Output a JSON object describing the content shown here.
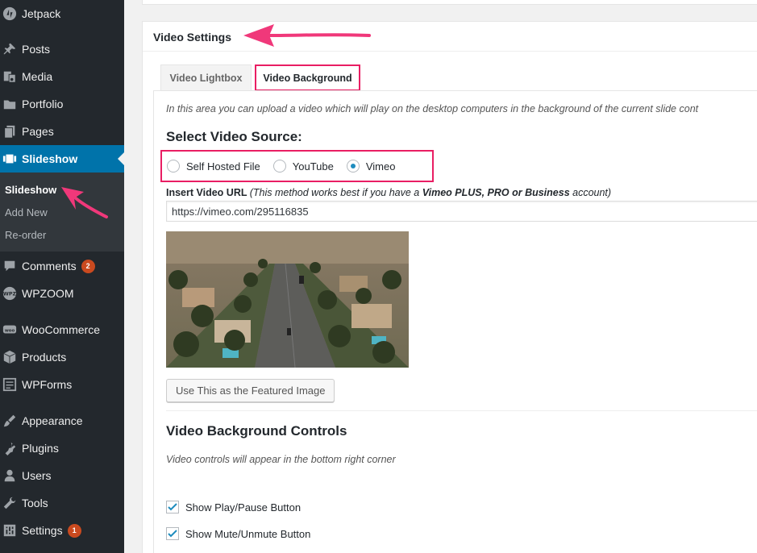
{
  "sidebar": {
    "items": [
      {
        "label": "Jetpack",
        "icon": "jetpack-icon"
      },
      {
        "label": "Posts",
        "icon": "pin-icon"
      },
      {
        "label": "Media",
        "icon": "media-icon"
      },
      {
        "label": "Portfolio",
        "icon": "folder-icon"
      },
      {
        "label": "Pages",
        "icon": "pages-icon"
      },
      {
        "label": "Slideshow",
        "icon": "slideshow-icon"
      },
      {
        "label": "Comments",
        "icon": "comment-icon",
        "badge": "2"
      },
      {
        "label": "WPZOOM",
        "icon": "wpzoom-icon"
      },
      {
        "label": "WooCommerce",
        "icon": "woo-icon"
      },
      {
        "label": "Products",
        "icon": "box-icon"
      },
      {
        "label": "WPForms",
        "icon": "forms-icon"
      },
      {
        "label": "Appearance",
        "icon": "brush-icon"
      },
      {
        "label": "Plugins",
        "icon": "plug-icon"
      },
      {
        "label": "Users",
        "icon": "user-icon"
      },
      {
        "label": "Tools",
        "icon": "wrench-icon"
      },
      {
        "label": "Settings",
        "icon": "sliders-icon",
        "badge": "1"
      }
    ],
    "submenu": [
      "Slideshow",
      "Add New",
      "Re-order"
    ]
  },
  "panel": {
    "title": "Video Settings",
    "tabs": [
      "Video Lightbox",
      "Video Background"
    ],
    "intro": "In this area you can upload a video which will play on the desktop computers in the background of the current slide cont",
    "source_heading": "Select Video Source:",
    "sources": [
      "Self Hosted File",
      "YouTube",
      "Vimeo"
    ],
    "selected_source": "Vimeo",
    "url_label": "Insert Video URL",
    "url_note_prefix": "(This method works best if you have a ",
    "url_note_bold": "Vimeo PLUS, PRO or Business",
    "url_note_suffix": " account)",
    "url_value": "https://vimeo.com/295116835",
    "featured_button": "Use This as the Featured Image",
    "controls_heading": "Video Background Controls",
    "controls_note": "Video controls will appear in the bottom right corner",
    "checkboxes": [
      {
        "label": "Show Play/Pause Button",
        "checked": true
      },
      {
        "label": "Show Mute/Unmute Button",
        "checked": true
      }
    ]
  },
  "colors": {
    "sidebar_bg": "#23282d",
    "active_bg": "#0073aa",
    "highlight": "#e91e63",
    "badge": "#ca4a1f"
  }
}
